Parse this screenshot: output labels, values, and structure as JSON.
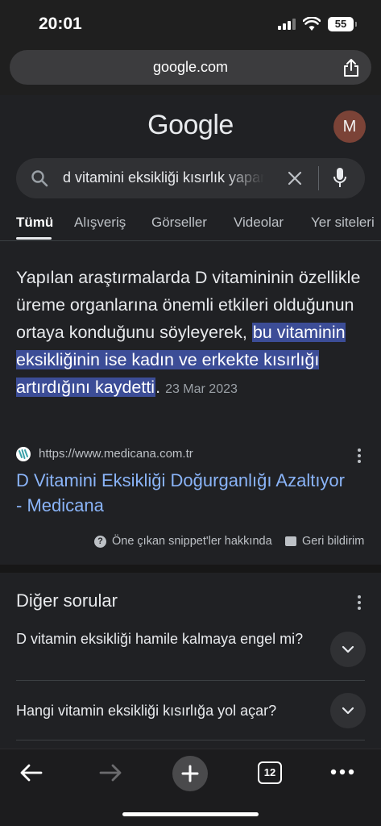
{
  "status": {
    "time": "20:01",
    "battery": "55"
  },
  "browser": {
    "url": "google.com",
    "tab_count": "12"
  },
  "google": {
    "logo": "Google",
    "avatar_initial": "M",
    "query": "d vitamini eksikliği kısırlık yapar mı",
    "tabs": [
      "Tümü",
      "Alışveriş",
      "Görseller",
      "Videolar",
      "Yer siteleri"
    ]
  },
  "snippet": {
    "text_before": "Yapılan araştırmalarda D vitamininin özellikle üreme organlarına önemli etkileri olduğunun ortaya konduğunu söyleyerek, ",
    "highlight": "bu vitaminin eksikliğinin ise kadın ve erkekte kısırlığı artırdığını kaydetti",
    "text_after": ".",
    "date": "23 Mar 2023",
    "source_url": "https://www.medicana.com.tr",
    "title": "D Vitamini Eksikliği Doğurganlığı Azaltıyor - Medicana",
    "about_label": "Öne çıkan snippet'ler hakkında",
    "feedback_label": "Geri bildirim"
  },
  "paa": {
    "title": "Diğer sorular",
    "questions": [
      "D vitamin eksikliği hamile kalmaya engel mi?",
      "Hangi vitamin eksikliği kısırlığa yol açar?"
    ]
  },
  "icons": {
    "share": "share-icon",
    "search": "search-icon",
    "clear": "close-icon",
    "mic": "mic-icon",
    "back": "arrow-left-icon",
    "forward": "arrow-right-icon",
    "new_tab": "plus-icon",
    "more": "more-horizontal-icon"
  },
  "colors": {
    "background": "#202124",
    "link": "#8ab4f8",
    "highlight": "#3c4d97",
    "avatar": "#7b4337"
  }
}
